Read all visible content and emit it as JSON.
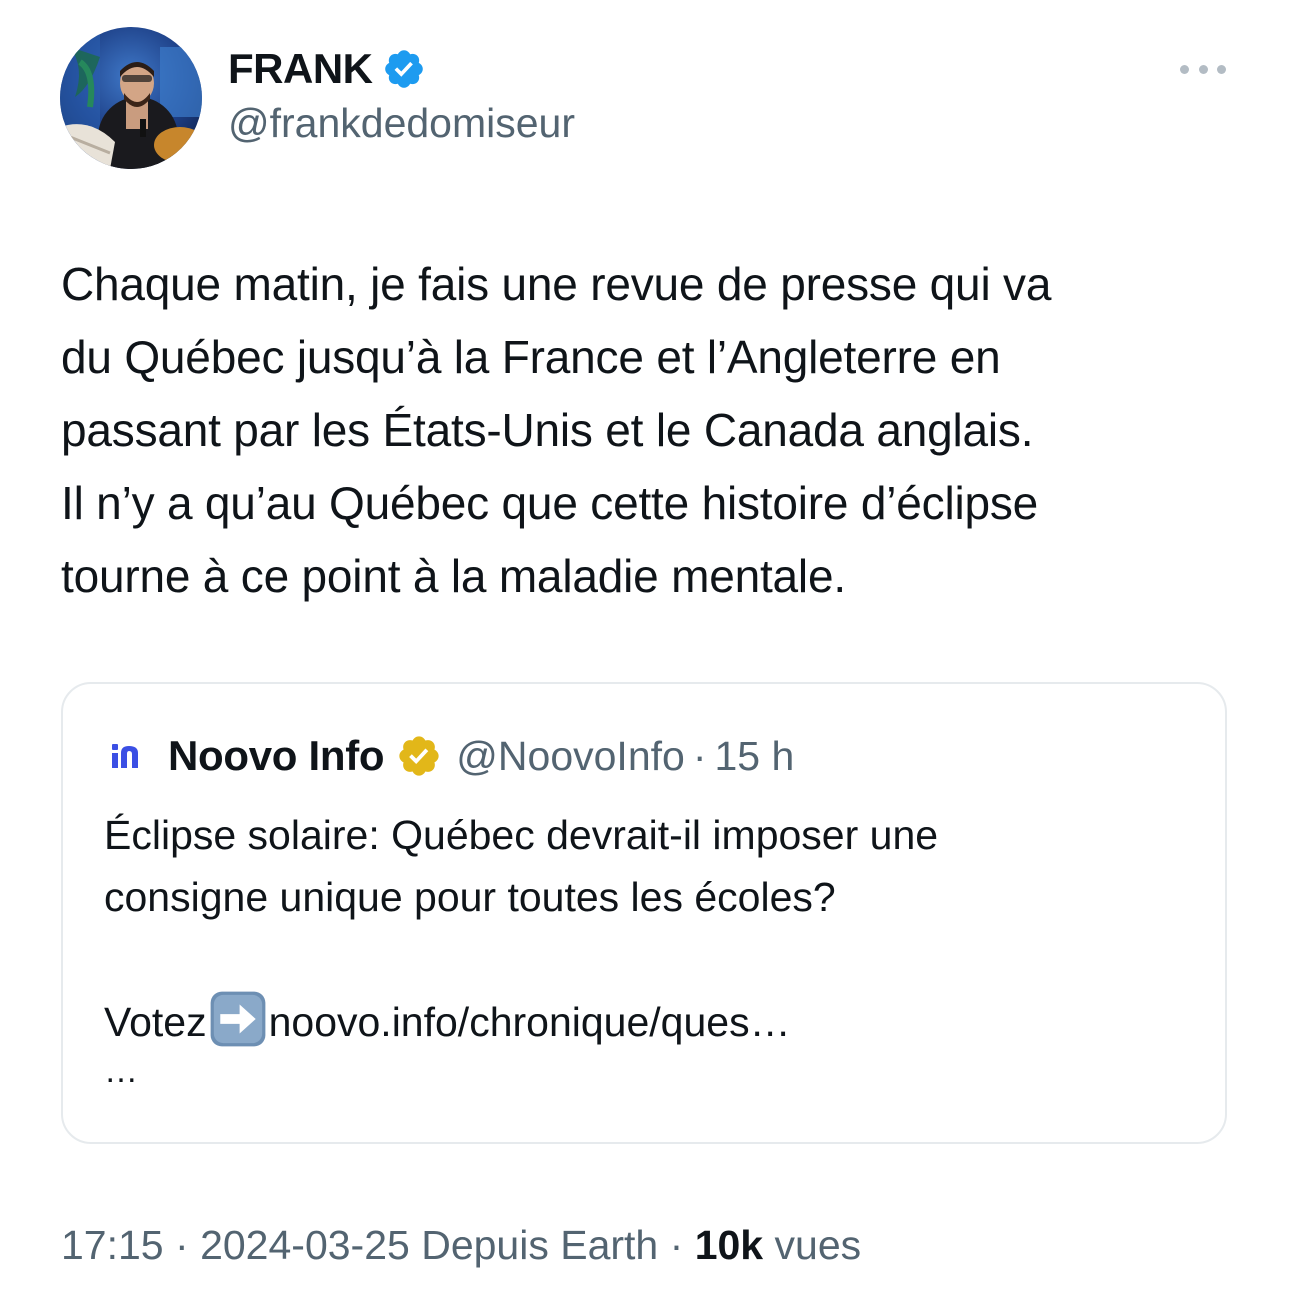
{
  "author": {
    "name": "FRANK",
    "handle": "@frankdedomiseur",
    "verified_badge_icon": "blue-verified-check-icon",
    "more_icon": "more-options-icon"
  },
  "tweet": {
    "text": "Chaque matin, je fais une revue de presse qui va\ndu Québec jusqu’à la France et l’Angleterre en\npassant par les États-Unis et le Canada anglais.\nIl n’y a qu’au Québec que cette histoire d’éclipse\ntourne à ce point à la maladie mentale."
  },
  "quoted_tweet": {
    "logo_icon": "noovo-logo-icon",
    "name": "Noovo Info",
    "badge_icon": "gold-verified-badge-icon",
    "handle": "@NoovoInfo",
    "separator": "·",
    "time": "15 h",
    "line1": "Éclipse solaire: Québec devrait-il imposer une",
    "line2": "consigne unique pour toutes les écoles?",
    "vote_prefix": "Votez",
    "arrow_icon": "right-arrow-emoji-icon",
    "link": "noovo.info/chronique/ques…",
    "ellipsis": "…"
  },
  "meta": {
    "time": "17:15",
    "sep1": "·",
    "date": "2024-03-25",
    "source": "Depuis Earth",
    "sep2": "·",
    "views_count": "10k",
    "views_label": "vues"
  },
  "colors": {
    "text_primary": "#0f1419",
    "text_secondary": "#536471",
    "verified_blue": "#1d9bf0",
    "verified_gold": "#e2b719",
    "noovo_blue": "#3b4fe4",
    "border": "#e6eaed"
  }
}
